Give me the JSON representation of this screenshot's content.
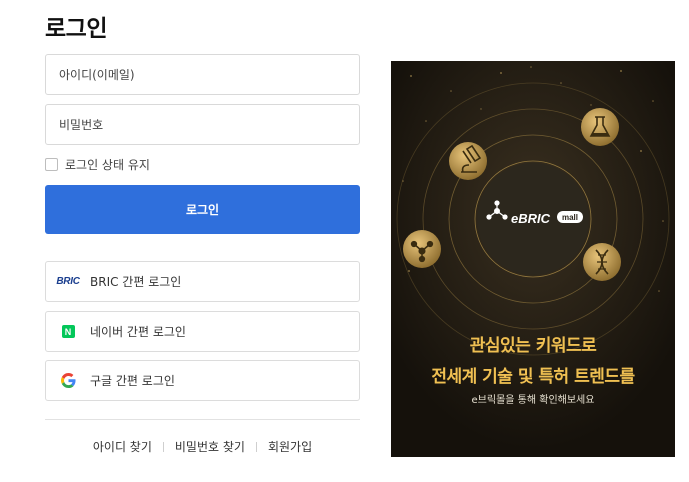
{
  "page": {
    "title": "로그인"
  },
  "form": {
    "id_placeholder": "아이디(이메일)",
    "pw_placeholder": "비밀번호",
    "keep_label": "로그인 상태 유지",
    "submit_label": "로그인"
  },
  "sso": [
    {
      "logo_text": "BRIC",
      "label": "BRIC 간편 로그인",
      "icon": "bric-logo-icon"
    },
    {
      "logo_text": "N",
      "label": "네이버 간편 로그인",
      "icon": "naver-icon"
    },
    {
      "logo_text": "G",
      "label": "구글 간편 로그인",
      "icon": "google-icon"
    }
  ],
  "links": {
    "find_id": "아이디 찾기",
    "find_pw": "비밀번호 찾기",
    "signup": "회원가입"
  },
  "banner": {
    "logo_text": "eBRIC",
    "logo_badge": "mall",
    "headline_1": "관심있는 키워드로",
    "headline_2": "전세계 기술 및 특허 트렌드를",
    "subtext": "e브릭몰을 통해 확인해보세요"
  },
  "colors": {
    "primary": "#2f6fdc",
    "naver": "#03c75a",
    "banner_bg": "#15110b",
    "banner_gold": "#f0c052"
  }
}
